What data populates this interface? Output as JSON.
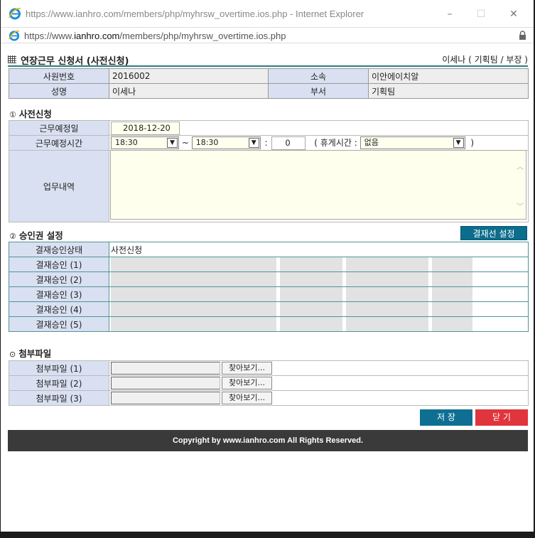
{
  "window": {
    "title": "https://www.ianhro.com/members/php/myhrsw_overtime.ios.php - Internet Explorer",
    "address_prefix": "https://www.",
    "address_host": "ianhro.com",
    "address_path": "/members/php/myhrsw_overtime.ios.php",
    "buttons": {
      "minimize": "–",
      "maximize": "☐",
      "close": "✕"
    }
  },
  "header": {
    "title": "연장근무 신청서 (사전신청)",
    "user": "이세나 ( 기획팀 / 부장 )"
  },
  "employee": {
    "emp_no_label": "사원번호",
    "emp_no": "2016002",
    "dept_label": "소속",
    "dept": "이안에이치알",
    "name_label": "성명",
    "name": "이세나",
    "team_label": "부서",
    "team": "기획팀"
  },
  "section1": {
    "num": "①",
    "title": "사전신청",
    "date_label": "근무예정일",
    "date_value": "2018-12-20",
    "time_label": "근무예정시간",
    "start_time": "18:30",
    "tilde": "~",
    "end_time": "18:30",
    "colon": ":",
    "minutes": "0",
    "break_prefix": "( 휴게시간 :",
    "break_value": "없음",
    "break_suffix": ")",
    "content_label": "업무내역"
  },
  "section2": {
    "num": "②",
    "title": "승인권 설정",
    "set_button": "결재선 설정",
    "status_label": "결재승인상태",
    "status_value": "사전신청",
    "approvers": [
      "결재승인 (1)",
      "결재승인 (2)",
      "결재승인 (3)",
      "결재승인 (4)",
      "결재승인 (5)"
    ]
  },
  "section3": {
    "num": "⊙",
    "title": "첨부파일",
    "files": [
      "첨부파일 (1)",
      "첨부파일 (2)",
      "첨부파일 (3)"
    ],
    "browse_label": "찾아보기..."
  },
  "actions": {
    "save": "저 장",
    "close": "닫 기"
  },
  "footer": "Copyright by www.ianhro.com All Rights Reserved."
}
